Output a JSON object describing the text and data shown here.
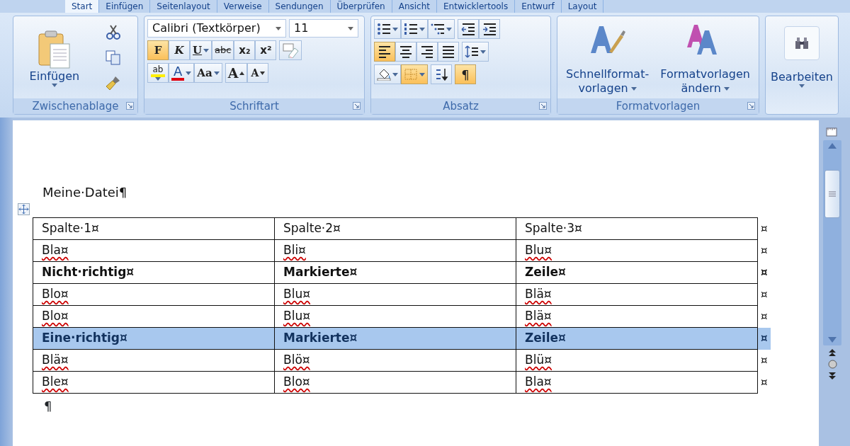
{
  "tabs": [
    {
      "label": "Start",
      "selected": true
    },
    {
      "label": "Einfügen",
      "selected": false
    },
    {
      "label": "Seitenlayout",
      "selected": false
    },
    {
      "label": "Verweise",
      "selected": false
    },
    {
      "label": "Sendungen",
      "selected": false
    },
    {
      "label": "Überprüfen",
      "selected": false
    },
    {
      "label": "Ansicht",
      "selected": false
    },
    {
      "label": "Entwicklertools",
      "selected": false
    },
    {
      "label": "Entwurf",
      "selected": false
    },
    {
      "label": "Layout",
      "selected": false
    }
  ],
  "clipboard": {
    "title": "Zwischenablage",
    "paste_label": "Einfügen"
  },
  "font": {
    "title": "Schriftart",
    "font_name": "Calibri (Textkörper)",
    "font_size": "11",
    "format_buttons": [
      {
        "kind": "bold",
        "label": "F",
        "on": true
      },
      {
        "kind": "italic",
        "label": "K",
        "on": false
      },
      {
        "kind": "underline",
        "label": "U",
        "on": false
      },
      {
        "kind": "strike",
        "label": "abc",
        "on": false
      },
      {
        "kind": "sub",
        "label": "x₂",
        "on": false
      },
      {
        "kind": "sup",
        "label": "x²",
        "on": false
      }
    ],
    "tools": [
      {
        "kind": "highlight",
        "label": "ab"
      },
      {
        "kind": "font-color",
        "label": "A"
      },
      {
        "kind": "case",
        "label": "Aa"
      },
      {
        "kind": "grow",
        "label": "A"
      },
      {
        "kind": "shrink",
        "label": "A"
      }
    ]
  },
  "paragraph": {
    "title": "Absatz",
    "align_buttons": [
      {
        "kind": "left",
        "on": true
      },
      {
        "kind": "center",
        "on": false
      },
      {
        "kind": "right",
        "on": false
      },
      {
        "kind": "justify",
        "on": false
      }
    ],
    "borders_on": true,
    "pilcrow": {
      "label": "¶",
      "on": true
    }
  },
  "styles": {
    "title": "Formatvorlagen",
    "buttons": [
      {
        "kind": "quick",
        "lines": [
          "Schnellformat-",
          "vorlagen"
        ]
      },
      {
        "kind": "change",
        "lines": [
          "Formatvorlagen",
          "ändern"
        ]
      }
    ]
  },
  "editing": {
    "label": "Bearbeiten"
  },
  "document": {
    "heading": "Meine·Datei¶",
    "rows": [
      {
        "bold": false,
        "selected": false,
        "end_mark": "¤",
        "cells": [
          {
            "text": "Spalte·1¤",
            "misspelled": false
          },
          {
            "text": "Spalte·2¤",
            "misspelled": false
          },
          {
            "text": "Spalte·3¤",
            "misspelled": false
          }
        ]
      },
      {
        "bold": false,
        "selected": false,
        "end_mark": "¤",
        "cells": [
          {
            "text": "Bla¤",
            "misspelled": true
          },
          {
            "text": "Bli¤",
            "misspelled": true
          },
          {
            "text": "Blu¤",
            "misspelled": true
          }
        ]
      },
      {
        "bold": true,
        "selected": false,
        "end_mark": "¤",
        "cells": [
          {
            "text": "Nicht·richtig¤",
            "misspelled": false
          },
          {
            "text": "Markierte¤",
            "misspelled": false
          },
          {
            "text": "Zeile¤",
            "misspelled": false
          }
        ]
      },
      {
        "bold": false,
        "selected": false,
        "end_mark": "¤",
        "cells": [
          {
            "text": "Blo¤",
            "misspelled": true
          },
          {
            "text": "Blu¤",
            "misspelled": true
          },
          {
            "text": "Blä¤",
            "misspelled": true
          }
        ]
      },
      {
        "bold": false,
        "selected": false,
        "end_mark": "¤",
        "cells": [
          {
            "text": "Blo¤",
            "misspelled": true
          },
          {
            "text": "Blu¤",
            "misspelled": true
          },
          {
            "text": "Blä¤",
            "misspelled": true
          }
        ]
      },
      {
        "bold": true,
        "selected": true,
        "end_mark": "¤",
        "cells": [
          {
            "text": "Eine·richtig¤",
            "misspelled": false
          },
          {
            "text": "Markierte¤",
            "misspelled": false
          },
          {
            "text": "Zeile¤",
            "misspelled": false
          }
        ]
      },
      {
        "bold": false,
        "selected": false,
        "end_mark": "¤",
        "cells": [
          {
            "text": "Blä¤",
            "misspelled": true
          },
          {
            "text": "Blö¤",
            "misspelled": true
          },
          {
            "text": "Blü¤",
            "misspelled": true
          }
        ]
      },
      {
        "bold": false,
        "selected": false,
        "end_mark": "¤",
        "cells": [
          {
            "text": "Ble¤",
            "misspelled": true
          },
          {
            "text": "Blo¤",
            "misspelled": true
          },
          {
            "text": "Bla¤",
            "misspelled": true
          }
        ]
      }
    ],
    "end_paragraph": "¶"
  }
}
